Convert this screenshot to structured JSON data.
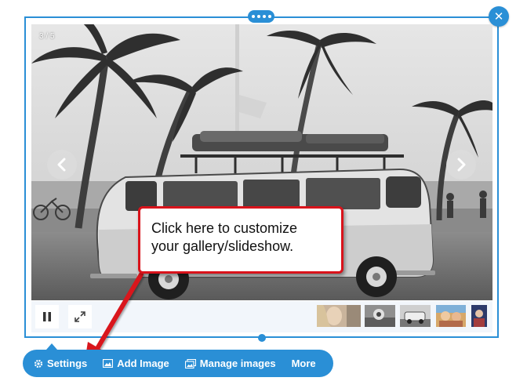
{
  "gallery": {
    "counter": "3 / 5"
  },
  "callout": {
    "line1": "Click here to customize",
    "line2": "your gallery/slideshow."
  },
  "toolbar": {
    "settings_label": "Settings",
    "add_image_label": "Add Image",
    "manage_images_label": "Manage images",
    "more_label": "More"
  },
  "colors": {
    "accent": "#2a8fd6",
    "callout_red": "#d9131b"
  },
  "icons": {
    "close": "close-icon",
    "prev": "chevron-left-icon",
    "next": "chevron-right-icon",
    "pause": "pause-icon",
    "fullscreen": "fullscreen-icon",
    "settings": "gear-icon",
    "add_image": "image-icon",
    "manage_images": "images-icon"
  }
}
